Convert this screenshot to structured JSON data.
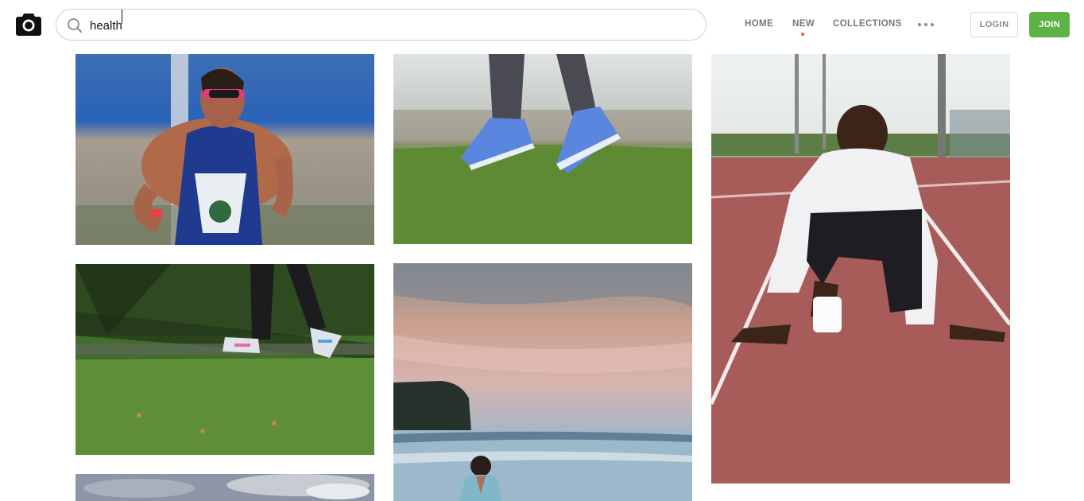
{
  "brand": {
    "logo_icon": "camera-icon"
  },
  "search": {
    "value": "health",
    "placeholder": "",
    "icon": "search-icon"
  },
  "nav": {
    "home": "HOME",
    "new": "NEW",
    "collections": "COLLECTIONS",
    "more_icon": "more-horizontal-icon",
    "new_indicator_color": "#e35a3f"
  },
  "auth": {
    "login": "LOGIN",
    "join": "JOIN"
  },
  "colors": {
    "join_green": "#5eb246",
    "nav_gray": "#777777"
  },
  "photos": [
    {
      "subject": "woman runner in sunglasses"
    },
    {
      "subject": "jumping feet in blue sneakers over grass"
    },
    {
      "subject": "sprinter in starting position on red track"
    },
    {
      "subject": "legs walking on grass with shadows"
    },
    {
      "subject": "person meditating at sunset beach"
    },
    {
      "subject": "cloudy sky"
    }
  ]
}
